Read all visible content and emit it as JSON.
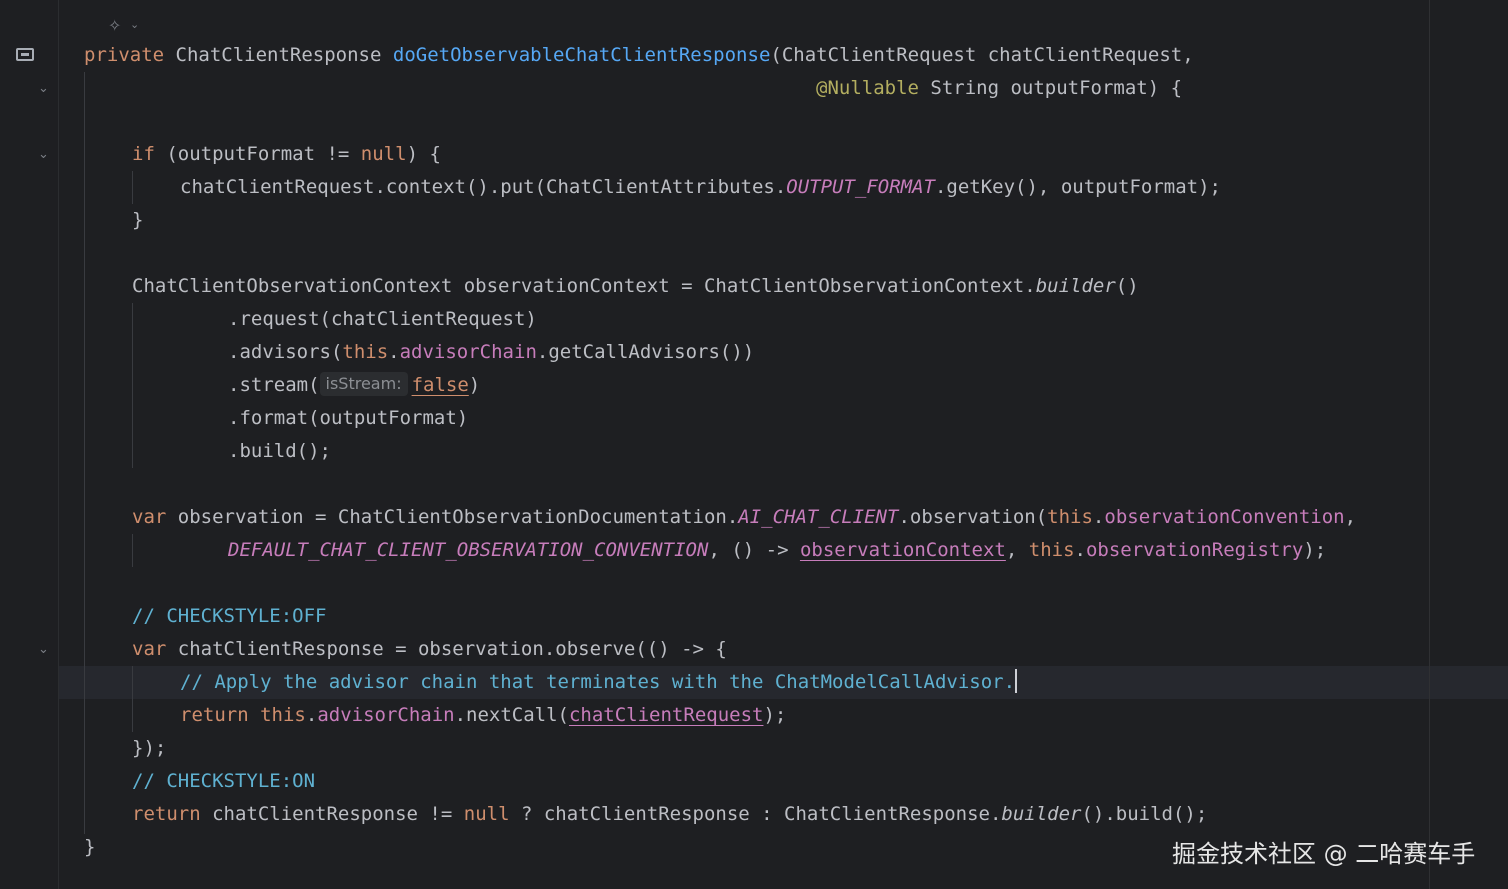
{
  "editor": {
    "lines": {
      "l1": [
        "private",
        " ",
        "ChatClientResponse",
        " ",
        "doGetObservableChatClientResponse",
        "(ChatClientRequest chatClientRequest,"
      ],
      "l2": [
        "@Nullable",
        " String outputFormat) {"
      ],
      "l3": [
        "if",
        " (outputFormat != ",
        "null",
        ") {"
      ],
      "l4": [
        "chatClientRequest.context().put(ChatClientAttributes.",
        "OUTPUT_FORMAT",
        ".getKey(), outputFormat);"
      ],
      "l5": [
        "}"
      ],
      "l6": [
        "ChatClientObservationContext observationContext = ChatClientObservationContext.",
        "builder",
        "()"
      ],
      "l7": [
        ".request(chatClientRequest)"
      ],
      "l8": [
        ".advisors(",
        "this",
        ".",
        "advisorChain",
        ".getCallAdvisors())"
      ],
      "l9": [
        ".stream(",
        "isStream:",
        "false",
        ")"
      ],
      "l10": [
        ".format(outputFormat)"
      ],
      "l11": [
        ".build();"
      ],
      "l12": [
        "var",
        " observation = ChatClientObservationDocumentation.",
        "AI_CHAT_CLIENT",
        ".observation(",
        "this",
        ".",
        "observationConvention",
        ","
      ],
      "l13": [
        "DEFAULT_CHAT_CLIENT_OBSERVATION_CONVENTION",
        ", () -> ",
        "observationContext",
        ", ",
        "this",
        ".",
        "observationRegistry",
        ");"
      ],
      "l14": [
        "// CHECKSTYLE:OFF"
      ],
      "l15": [
        "var",
        " chatClientResponse = observation.observe(() -> {"
      ],
      "l16": [
        "// Apply the advisor chain that terminates with the ChatModelCallAdvisor."
      ],
      "l17": [
        "return",
        " ",
        "this",
        ".",
        "advisorChain",
        ".nextCall(",
        "chatClientRequest",
        ");"
      ],
      "l18": [
        "});"
      ],
      "l19": [
        "// CHECKSTYLE:ON"
      ],
      "l20": [
        "return",
        " chatClientResponse != ",
        "null",
        " ? chatClientResponse : ChatClientResponse.",
        "builder",
        "().build();"
      ],
      "l21": [
        "}"
      ]
    }
  },
  "icons": {
    "ai_assistant": "sparkle-icon",
    "bookmark": "bookmark-icon",
    "fold": "fold-chevron-icon"
  },
  "colors": {
    "background": "#1e1f22",
    "keyword": "#cf8e6d",
    "method": "#56a8f5",
    "field": "#c77dbb",
    "annotation": "#b3ae60",
    "comment": "#5fb1d1",
    "text": "#bcbec4"
  },
  "watermark": "掘金技术社区 @ 二哈赛车手"
}
